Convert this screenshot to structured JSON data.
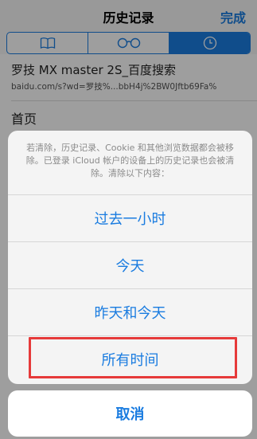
{
  "navbar": {
    "title": "历史记录",
    "done": "完成"
  },
  "tabs": [
    {
      "icon": "book-icon"
    },
    {
      "icon": "glasses-icon"
    },
    {
      "icon": "clock-icon",
      "active": true
    }
  ],
  "history": {
    "item_title": "罗技 MX master 2S_百度搜索",
    "item_url": "baidu.com/s?wd=罗技%...bbH4j%2BW0Jftb69Fa%",
    "home": "首页"
  },
  "sheet": {
    "message": "若清除，历史记录、Cookie 和其他浏览数据都会被移除。已登录 iCloud 帐户的设备上的历史记录也会被清除。清除以下内容：",
    "options": [
      "过去一小时",
      "今天",
      "昨天和今天",
      "所有时间"
    ],
    "cancel": "取消"
  },
  "colors": {
    "accent": "#1a7ce0",
    "highlight": "#e63a3a"
  }
}
